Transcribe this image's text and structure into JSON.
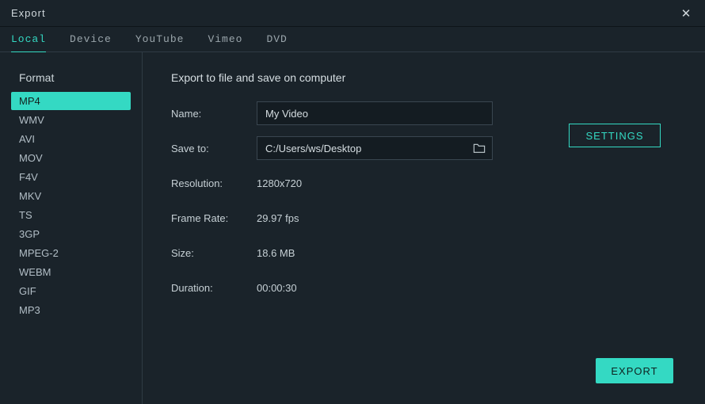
{
  "window": {
    "title": "Export"
  },
  "tabs": {
    "items": [
      {
        "label": "Local",
        "active": true
      },
      {
        "label": "Device",
        "active": false
      },
      {
        "label": "YouTube",
        "active": false
      },
      {
        "label": "Vimeo",
        "active": false
      },
      {
        "label": "DVD",
        "active": false
      }
    ]
  },
  "sidebar": {
    "heading": "Format",
    "items": [
      {
        "label": "MP4",
        "selected": true
      },
      {
        "label": "WMV",
        "selected": false
      },
      {
        "label": "AVI",
        "selected": false
      },
      {
        "label": "MOV",
        "selected": false
      },
      {
        "label": "F4V",
        "selected": false
      },
      {
        "label": "MKV",
        "selected": false
      },
      {
        "label": "TS",
        "selected": false
      },
      {
        "label": "3GP",
        "selected": false
      },
      {
        "label": "MPEG-2",
        "selected": false
      },
      {
        "label": "WEBM",
        "selected": false
      },
      {
        "label": "GIF",
        "selected": false
      },
      {
        "label": "MP3",
        "selected": false
      }
    ]
  },
  "main": {
    "heading": "Export to file and save on computer",
    "name_label": "Name:",
    "name_value": "My Video",
    "save_to_label": "Save to:",
    "save_to_value": "C:/Users/ws/Desktop",
    "resolution_label": "Resolution:",
    "resolution_value": "1280x720",
    "frame_rate_label": "Frame Rate:",
    "frame_rate_value": "29.97 fps",
    "size_label": "Size:",
    "size_value": "18.6 MB",
    "duration_label": "Duration:",
    "duration_value": "00:00:30",
    "settings_button": "SETTINGS",
    "export_button": "EXPORT"
  },
  "colors": {
    "accent": "#34d9c3",
    "bg": "#1a232a",
    "input_bg": "#141c22",
    "border": "#3a4650"
  }
}
